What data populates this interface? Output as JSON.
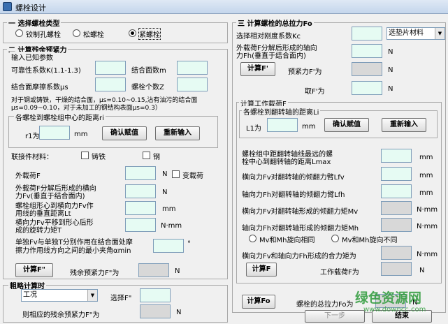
{
  "window": {
    "title": "螺栓设计"
  },
  "s1": {
    "title": "一 选择螺栓类型",
    "r1": "铰制孔螺栓",
    "r2": "松螺栓",
    "r3": "紧螺栓"
  },
  "s2": {
    "title": "二 计算残余预紧力",
    "known": "输入已知参数",
    "reliability": "可靠性系数K(1.1-1.3)",
    "faces": "结合面数m",
    "friction": "结合面摩擦系数μs",
    "bolts": "螺栓个数Z",
    "note1": "对于钢或铸铁，干燥的结合面，μs=0.10~0.15,沾有油污的结合面",
    "note2": "μs=0.09~0.10，对于未加工的钢结构表面μs=0.3）",
    "dist_group": "各螺栓到螺栓组中心的距离ri",
    "r1": "r1为",
    "mm": "mm",
    "confirm": "确认赋值",
    "reenter": "重新输入",
    "material": "联接件材料：",
    "castiron": "铸铁",
    "steel": "钢",
    "external": "外载荷F",
    "n": "N",
    "varload": "变载荷",
    "fv_a": "外载荷F分解后形成的横向",
    "fv_b": "力Fv(垂直于结合面内)",
    "lt_a": "螺栓组形心到横向力Fv作",
    "lt_b": "用线的垂直距离Lt",
    "t_a": "横向力Fv平移到形心后形",
    "t_b": "成的旋转力矩T",
    "nmm": "N·mm",
    "angle_a": "单独Fv与单独T分别作用在结合面处摩",
    "angle_b": "擦力作用线方向之间的最小夹角αmin",
    "deg": "°",
    "calc_btn": "计算F\"",
    "residual": "残余预紧力F\"为"
  },
  "rough": {
    "title": "粗略计算时",
    "cond": "工况",
    "choose": "选择F\"",
    "corr": "则相应的残余预紧力F\"为",
    "n": "N"
  },
  "s3": {
    "title": "三 计算螺栓的总拉力Fo",
    "kc": "选择相对刚度系数Kc",
    "kc_select": "选垫片材料",
    "fh_a": "外载荷F分解后形成的轴向",
    "fh_b": "力Fh(垂直于结合面内)",
    "n": "N",
    "calc_btn": "计算F'",
    "pre": "预紧力F'为",
    "take": "取F'为",
    "work_group": "计算工作载荷F",
    "dist_group": "各螺栓到翻转轴的距离Li",
    "l1": "L1为",
    "mm": "mm",
    "confirm": "确认赋值",
    "reenter": "重新输入",
    "lmax_a": "螺栓组中距翻转轴线最远的螺",
    "lmax_b": "栓中心到翻转轴的距离Lmax",
    "lfv": "横向力Fv对翻转轴的倾翻力臂Lfv",
    "lfh": "轴向力Fh对翻转轴的倾翻力臂Lfh",
    "mv": "横向力Fv对翻转轴形成的倾翻力矩Mv",
    "mh": "轴向力Fh对翻转轴形成的倾翻力矩Mh",
    "nmm": "N·mm",
    "same": "Mv和Mh旋向相同",
    "diff": "Mv和Mh旋向不同",
    "resultant": "横向力Fv和轴向力Fh形成的合力矩为",
    "calc_f": "计算F",
    "work_load": "工作载荷F为",
    "calc_fo": "计算Fo",
    "total": "螺栓的总拉力Fo为",
    "next": "下一步",
    "end": "结束"
  },
  "watermark": {
    "big": "绿色资源网",
    "small": "www.downcc.com"
  },
  "colors": {
    "input_bg": "#e6fbf3",
    "disabled_bg": "#d8d8d8",
    "accent": "#2e9b3a"
  }
}
